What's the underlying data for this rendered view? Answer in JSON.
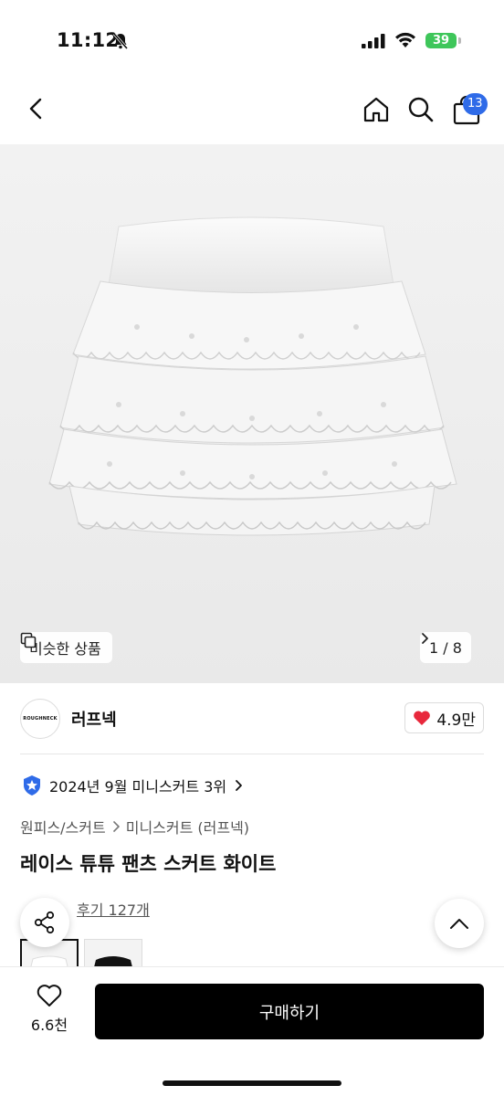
{
  "status_bar": {
    "time": "11:12",
    "battery": "39"
  },
  "nav": {
    "cart_count": "13"
  },
  "image": {
    "similar_label": "비슷한 상품",
    "page_indicator": "1 / 8"
  },
  "brand": {
    "logo_text": "ROUGHNECK",
    "name": "러프넥",
    "likes": "4.9만"
  },
  "ranking": {
    "text": "2024년 9월 미니스커트 3위"
  },
  "breadcrumb": {
    "category": "원피스/스커트",
    "subcategory": "미니스커트 (러프넥)"
  },
  "product": {
    "title": "레이스 튜튜 팬츠 스커트 화이트"
  },
  "reviews": {
    "label": "후기 127개"
  },
  "bottom": {
    "wish_count": "6.6천",
    "buy_label": "구매하기"
  },
  "colors": {
    "accent": "#2f6be8",
    "heart": "#e8283c",
    "battery": "#3ec65a"
  }
}
